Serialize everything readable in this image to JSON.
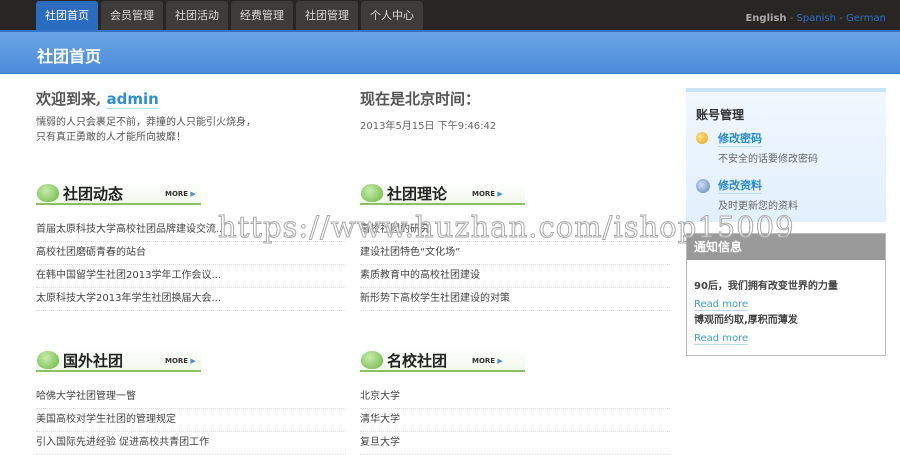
{
  "nav": {
    "tabs": [
      "社团首页",
      "会员管理",
      "社团活动",
      "经费管理",
      "社团管理",
      "个人中心"
    ],
    "active": 0
  },
  "lang": {
    "english": "English",
    "spanish": "Spanish",
    "german": "German",
    "sep": " - "
  },
  "page_title": "社团首页",
  "welcome": {
    "prefix": "欢迎到来,",
    "user": "admin",
    "quote1": "懦弱的人只会裹足不前，莽撞的人只能引火烧身，",
    "quote2": "只有真正勇敢的人才能所向披靡！"
  },
  "time": {
    "heading": "现在是北京时间：",
    "value": "2013年5月15日 下午9:46:42"
  },
  "more": "MORE",
  "sections": [
    {
      "title": "社团动态",
      "items": [
        "首届太原科技大学高校社团品牌建设交流...",
        "高校社团磨砺青春的站台",
        "在韩中国留学生社团2013学年工作会议...",
        "太原科技大学2013年学生社团换届大会..."
      ]
    },
    {
      "title": "社团理论",
      "items": [
        "高校社团的研究",
        "建设社团特色“文化场”",
        "素质教育中的高校社团建设",
        "新形势下高校学生社团建设的对策"
      ]
    },
    {
      "title": "国外社团",
      "items": [
        "哈佛大学社团管理一瞥",
        "美国高校对学生社团的管理规定",
        "引入国际先进经验 促进高校共青团工作"
      ]
    },
    {
      "title": "名校社团",
      "items": [
        "北京大学",
        "清华大学",
        "复旦大学"
      ]
    }
  ],
  "account": {
    "title": "账号管理",
    "items": [
      {
        "link": "修改密码",
        "desc": "不安全的话要修改密码",
        "icon": "key-icon"
      },
      {
        "link": "修改资料",
        "desc": "及时更新您的资料",
        "icon": "info-icon"
      }
    ]
  },
  "notice": {
    "title": "通知信息",
    "items": [
      "90后，我们拥有改变世界的力量",
      "博观而约取,厚积而薄发"
    ],
    "read_more": "Read more"
  },
  "watermark": "https://www.huzhan.com/ishop15009"
}
